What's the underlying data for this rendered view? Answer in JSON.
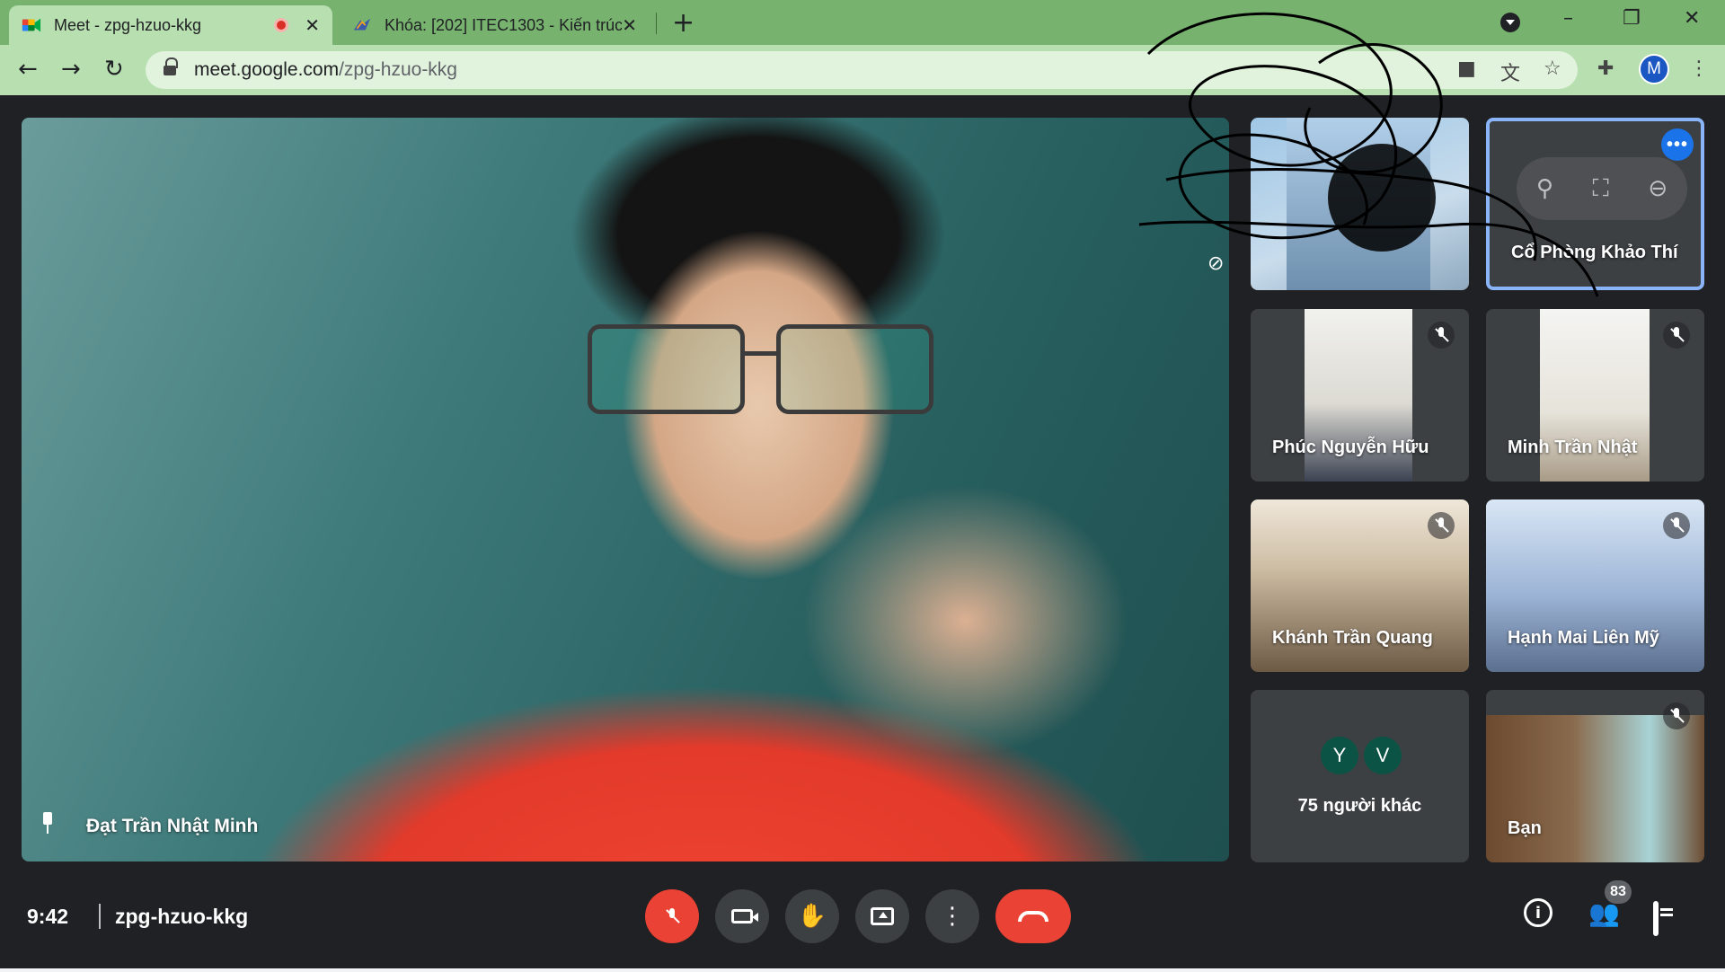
{
  "browser": {
    "tabs": [
      {
        "title": "Meet - zpg-hzuo-kkg",
        "active": true
      },
      {
        "title": "Khóa: [202] ITEC1303 - Kiến trúc",
        "active": false
      }
    ],
    "url_host": "meet.google.com",
    "url_path": "/zpg-hzuo-kkg",
    "profile_initial": "M"
  },
  "meet": {
    "main_speaker": "Đạt Trần Nhật Minh",
    "participants": [
      {
        "name": "",
        "muted": true
      },
      {
        "name": "Cổ Phòng Khảo Thí",
        "muted": false,
        "pinned_controls": true
      },
      {
        "name": "Phúc Nguyễn Hữu",
        "muted": true
      },
      {
        "name": "Minh Trần Nhật",
        "muted": true
      },
      {
        "name": "Khánh Trần Quang",
        "muted": true
      },
      {
        "name": "Hạnh Mai Liên Mỹ",
        "muted": true
      },
      {
        "name": "Bạn",
        "muted": true
      }
    ],
    "others": {
      "avatars": [
        "Y",
        "V"
      ],
      "label": "75 người khác"
    },
    "clock": "9:42",
    "meeting_code": "zpg-hzuo-kkg",
    "people_count": "83"
  },
  "colors": {
    "end_call": "#ea4335",
    "tab_green": "#77b36f",
    "highlight": "#8ab4f8"
  },
  "icons": {
    "mic": "mic-off-icon",
    "camera": "camera-icon",
    "hand": "raise-hand-icon",
    "present": "present-icon",
    "more": "more-vert-icon",
    "end": "end-call-icon",
    "info": "info-icon",
    "people": "people-icon",
    "chat": "chat-icon"
  }
}
